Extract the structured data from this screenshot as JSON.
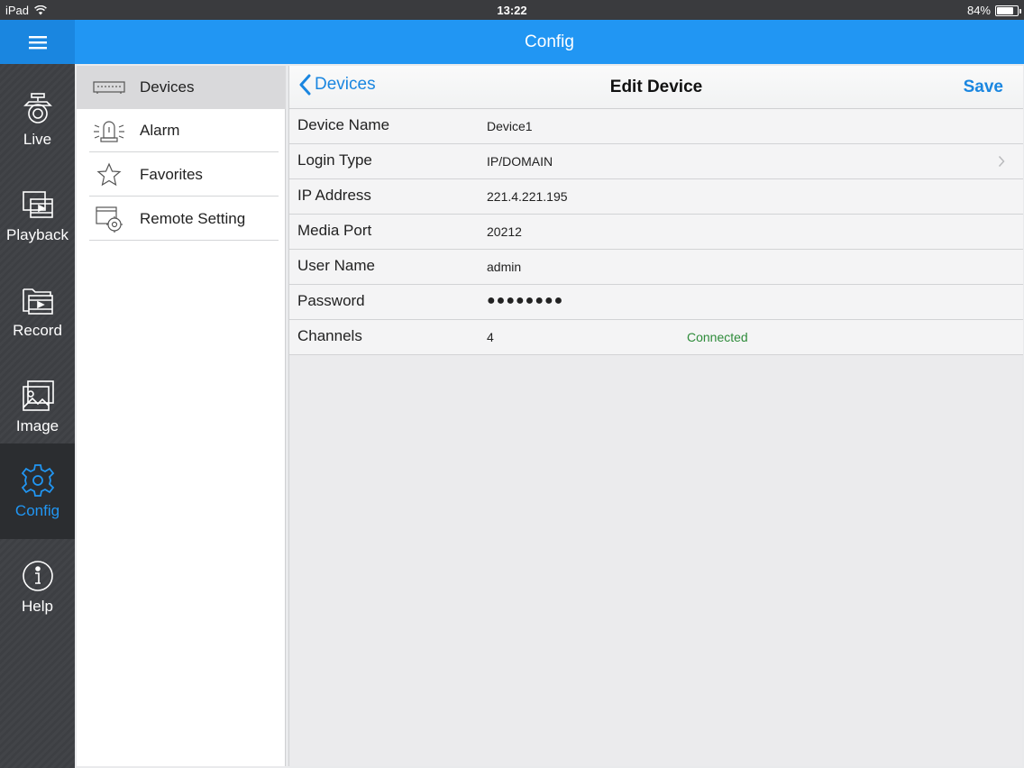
{
  "status_bar": {
    "device": "iPad",
    "time": "13:22",
    "battery": "84%",
    "battery_level": 0.84
  },
  "header": {
    "title": "Config"
  },
  "left_nav": {
    "items": [
      {
        "label": "Live",
        "icon": "camera-icon"
      },
      {
        "label": "Playback",
        "icon": "playback-icon"
      },
      {
        "label": "Record",
        "icon": "record-folder-icon"
      },
      {
        "label": "Image",
        "icon": "image-icon"
      },
      {
        "label": "Config",
        "icon": "gear-icon",
        "active": true
      },
      {
        "label": "Help",
        "icon": "info-icon"
      }
    ],
    "active_color": "#2196f3"
  },
  "config_menu": {
    "items": [
      {
        "label": "Devices",
        "icon": "dvr-device-icon",
        "selected": true
      },
      {
        "label": "Alarm",
        "icon": "alarm-light-icon"
      },
      {
        "label": "Favorites",
        "icon": "star-icon"
      },
      {
        "label": "Remote Setting",
        "icon": "remote-setting-icon"
      }
    ]
  },
  "edit_device": {
    "back_label": "Devices",
    "title": "Edit Device",
    "save_label": "Save",
    "fields": [
      {
        "label": "Device Name",
        "value": "Device1"
      },
      {
        "label": "Login Type",
        "value": "IP/DOMAIN",
        "has_chevron": true
      },
      {
        "label": "IP Address",
        "value": "221.4.221.195"
      },
      {
        "label": "Media Port",
        "value": "20212"
      },
      {
        "label": "User Name",
        "value": "admin"
      },
      {
        "label": "Password",
        "value": "●●●●●●●●"
      },
      {
        "label": "Channels",
        "value": "4",
        "status": "Connected"
      }
    ],
    "status_color": "#2e8b3a"
  }
}
